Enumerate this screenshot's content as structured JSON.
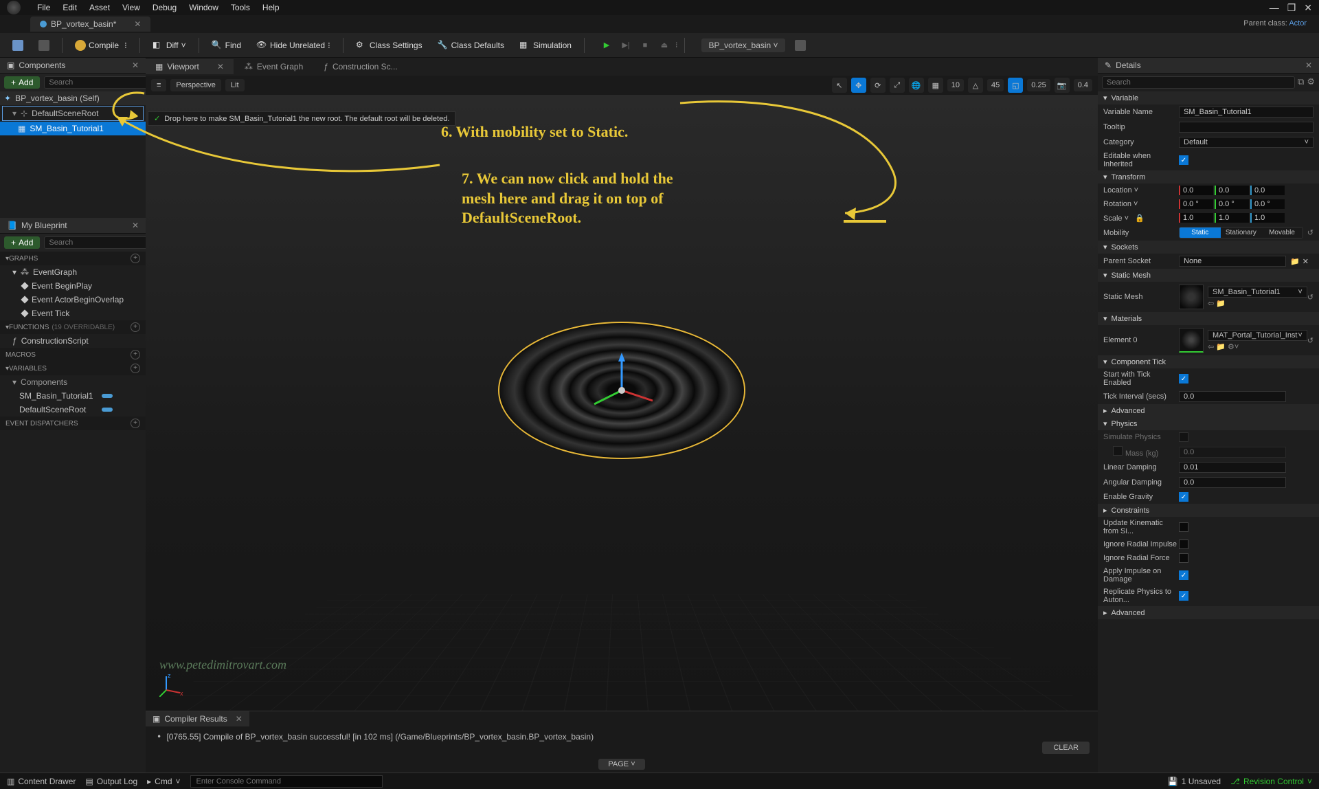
{
  "menu": {
    "items": [
      "File",
      "Edit",
      "Asset",
      "View",
      "Debug",
      "Window",
      "Tools",
      "Help"
    ]
  },
  "file_tab": {
    "name": "BP_vortex_basin*"
  },
  "parent_class": {
    "label": "Parent class:",
    "value": "Actor"
  },
  "toolbar": {
    "compile": "Compile",
    "diff": "Diff",
    "find": "Find",
    "hide_unrelated": "Hide Unrelated",
    "class_settings": "Class Settings",
    "class_defaults": "Class Defaults",
    "simulation": "Simulation",
    "bp_dropdown": "BP_vortex_basin"
  },
  "components_panel": {
    "title": "Components",
    "add": "Add",
    "search_placeholder": "Search",
    "items": [
      {
        "label": "BP_vortex_basin (Self)"
      },
      {
        "label": "DefaultSceneRoot"
      },
      {
        "label": "SM_Basin_Tutorial1"
      }
    ],
    "drop_hint": "Drop here to make SM_Basin_Tutorial1 the new root. The default root will be deleted."
  },
  "my_blueprint": {
    "title": "My Blueprint",
    "add": "Add",
    "search_placeholder": "Search",
    "graphs_hdr": "GRAPHS",
    "eventgraph": "EventGraph",
    "events": [
      "Event BeginPlay",
      "Event ActorBeginOverlap",
      "Event Tick"
    ],
    "functions_hdr": "FUNCTIONS",
    "functions_sub": "(19 OVERRIDABLE)",
    "construction": "ConstructionScript",
    "macros_hdr": "MACROS",
    "variables_hdr": "VARIABLES",
    "components_hdr": "Components",
    "vars": [
      "SM_Basin_Tutorial1",
      "DefaultSceneRoot"
    ],
    "dispatchers_hdr": "EVENT DISPATCHERS"
  },
  "center_tabs": {
    "viewport": "Viewport",
    "event_graph": "Event Graph",
    "construction": "Construction Sc..."
  },
  "viewport_bar": {
    "perspective": "Perspective",
    "lit": "Lit",
    "grid": "10",
    "angle": "45",
    "scale": "0.25",
    "camspeed": "0.4"
  },
  "annotations": {
    "step6": "6. With mobility set to Static.",
    "step7": "7. We can now click and hold the mesh here and drag it on top of DefaultSceneRoot.",
    "watermark": "www.petedimitrovart.com"
  },
  "compiler": {
    "title": "Compiler Results",
    "log": "[0765.55] Compile of BP_vortex_basin successful! [in 102 ms] (/Game/Blueprints/BP_vortex_basin.BP_vortex_basin)",
    "page": "PAGE",
    "clear": "CLEAR"
  },
  "details": {
    "title": "Details",
    "search_placeholder": "Search",
    "variable_hdr": "Variable",
    "var_name_lbl": "Variable Name",
    "var_name_val": "SM_Basin_Tutorial1",
    "tooltip_lbl": "Tooltip",
    "category_lbl": "Category",
    "category_val": "Default",
    "editable_lbl": "Editable when Inherited",
    "transform_hdr": "Transform",
    "location_lbl": "Location",
    "loc": {
      "x": "0.0",
      "y": "0.0",
      "z": "0.0"
    },
    "rotation_lbl": "Rotation",
    "rot": {
      "x": "0.0 °",
      "y": "0.0 °",
      "z": "0.0 °"
    },
    "scale_lbl": "Scale",
    "scl": {
      "x": "1.0",
      "y": "1.0",
      "z": "1.0"
    },
    "mobility_lbl": "Mobility",
    "mobility": {
      "static": "Static",
      "stationary": "Stationary",
      "movable": "Movable"
    },
    "sockets_hdr": "Sockets",
    "parent_socket_lbl": "Parent Socket",
    "parent_socket_val": "None",
    "static_mesh_hdr": "Static Mesh",
    "static_mesh_lbl": "Static Mesh",
    "static_mesh_val": "SM_Basin_Tutorial1",
    "materials_hdr": "Materials",
    "element0_lbl": "Element 0",
    "element0_val": "MAT_Portal_Tutorial_Inst",
    "comp_tick_hdr": "Component Tick",
    "tick_enabled_lbl": "Start with Tick Enabled",
    "tick_interval_lbl": "Tick Interval (secs)",
    "tick_interval_val": "0.0",
    "advanced_hdr": "Advanced",
    "physics_hdr": "Physics",
    "sim_physics_lbl": "Simulate Physics",
    "mass_lbl": "Mass (kg)",
    "mass_val": "0.0",
    "lin_damp_lbl": "Linear Damping",
    "lin_damp_val": "0.01",
    "ang_damp_lbl": "Angular Damping",
    "ang_damp_val": "0.0",
    "gravity_lbl": "Enable Gravity",
    "constraints_hdr": "Constraints",
    "update_kin_lbl": "Update Kinematic from Si...",
    "ign_impulse_lbl": "Ignore Radial Impulse",
    "ign_force_lbl": "Ignore Radial Force",
    "apply_impulse_lbl": "Apply Impulse on Damage",
    "replicate_lbl": "Replicate Physics to Auton..."
  },
  "status": {
    "content_drawer": "Content Drawer",
    "output_log": "Output Log",
    "cmd": "Cmd",
    "cmd_placeholder": "Enter Console Command",
    "unsaved": "1 Unsaved",
    "revision": "Revision Control"
  }
}
